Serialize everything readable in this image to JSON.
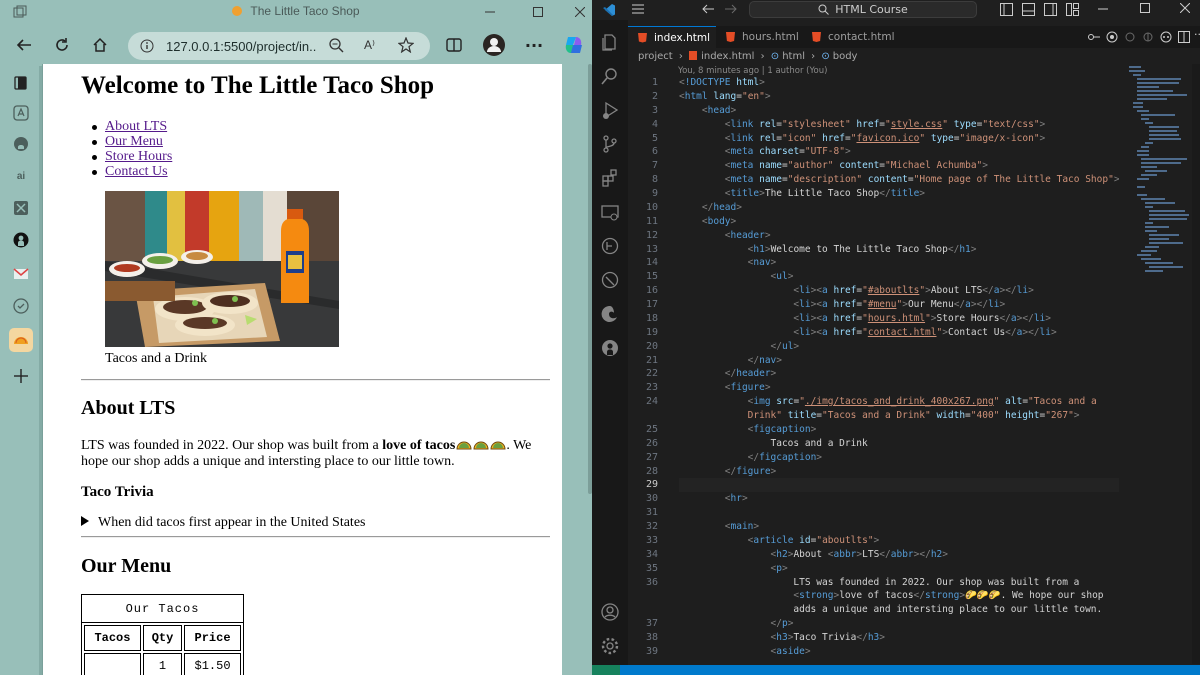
{
  "browser": {
    "tab_title": "The Little Taco Shop",
    "url": "127.0.0.1:5500/project/in...",
    "page": {
      "h1": "Welcome to The Little Taco Shop",
      "nav": [
        "About LTS",
        "Our Menu",
        "Store Hours",
        "Contact Us"
      ],
      "figcaption": "Tacos and a Drink",
      "about_heading": "About LTS",
      "about_p_before": "LTS was founded in 2022. Our shop was built from a ",
      "about_p_bold": "love of tacos",
      "about_p_after": ". We hope our shop adds a unique and intersting place to our little town.",
      "trivia_heading": "Taco Trivia",
      "trivia_question": "When did tacos first appear in the United States",
      "menu_heading": "Our Menu",
      "table_caption": "Our Tacos",
      "table_headers": [
        "Tacos",
        "Qty",
        "Price"
      ],
      "table_rows": [
        [
          "",
          "1",
          "$1.50"
        ]
      ]
    }
  },
  "vscode": {
    "command_center": "HTML Course",
    "tabs": [
      "index.html",
      "hours.html",
      "contact.html"
    ],
    "breadcrumb": [
      "project",
      "index.html",
      "html",
      "body"
    ],
    "blame": "You, 8 minutes ago | 1 author (You)",
    "line_numbers": [
      "1",
      "2",
      "3",
      "4",
      "5",
      "6",
      "7",
      "8",
      "9",
      "10",
      "11",
      "12",
      "13",
      "14",
      "15",
      "16",
      "17",
      "18",
      "19",
      "20",
      "21",
      "22",
      "23",
      "24",
      "",
      "25",
      "26",
      "27",
      "28",
      "29",
      "30",
      "31",
      "32",
      "33",
      "34",
      "35",
      "36",
      "",
      "",
      "37",
      "38",
      "39"
    ],
    "current_line": "29"
  },
  "colors": {
    "browser_frame": "#98bfb9",
    "link": "#551a8b",
    "vs_tag": "#569cd6",
    "vs_attr": "#9cdcfe",
    "vs_string": "#ce9178",
    "vs_status": "#007acc"
  }
}
